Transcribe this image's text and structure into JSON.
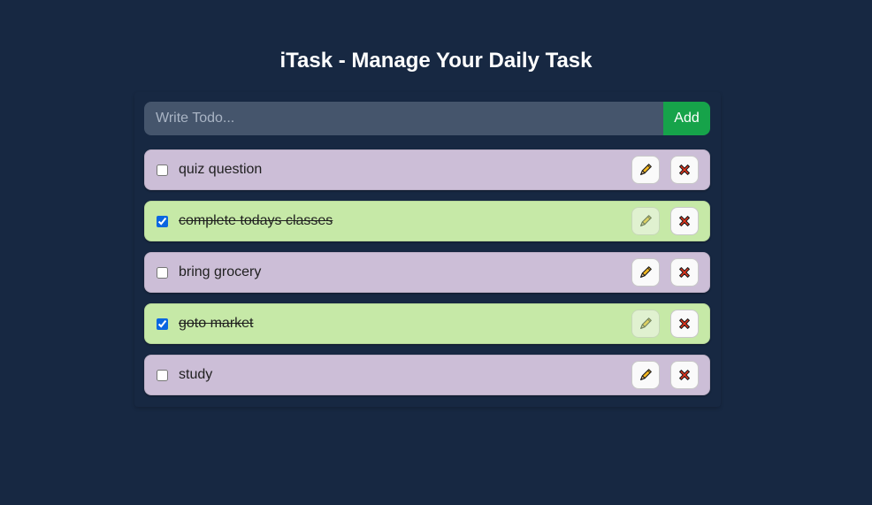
{
  "header": {
    "title": "iTask - Manage Your Daily Task"
  },
  "form": {
    "placeholder": "Write Todo...",
    "value": "",
    "add_label": "Add"
  },
  "todos": [
    {
      "text": "quiz question",
      "completed": false
    },
    {
      "text": "complete todays classes",
      "completed": true
    },
    {
      "text": "bring grocery",
      "completed": false
    },
    {
      "text": "goto market",
      "completed": true
    },
    {
      "text": "study",
      "completed": false
    }
  ],
  "colors": {
    "background": "#172842",
    "pending_item": "#ccbed7",
    "completed_item": "#c6e9a7",
    "add_button": "#16a34a",
    "input": "#45556c"
  },
  "icons": {
    "edit": "pencil-icon",
    "delete": "cross-mark-icon"
  }
}
